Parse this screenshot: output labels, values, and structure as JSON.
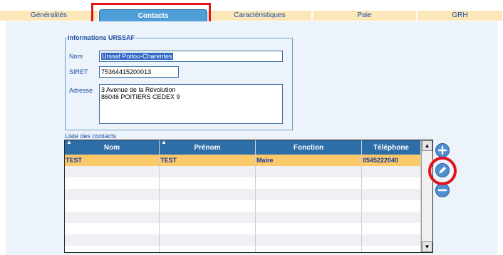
{
  "tabs": [
    {
      "label": "Généralités"
    },
    {
      "label": "Contacts",
      "active": true
    },
    {
      "label": "Caractéristiques"
    },
    {
      "label": "Paie"
    },
    {
      "label": "GRH"
    }
  ],
  "urssaf": {
    "legend": "Informations URSSAF",
    "nom_label": "Nom",
    "nom_value": "Urssaf Poitou-Charentes",
    "siret_label": "SIRET",
    "siret_value": "75364415200013",
    "adresse_label": "Adresse",
    "adresse_value": "3 Avenue de la Révolution\n86046 POITIERS CEDEX 9"
  },
  "contacts": {
    "title": "Liste des contacts",
    "columns": [
      "Nom",
      "Prénom",
      "Fonction",
      "Téléphone"
    ],
    "rows": [
      {
        "nom": "TEST",
        "prenom": "TEST",
        "fonction": "Maire",
        "telephone": "0545222040"
      }
    ],
    "selected_row_color": "#fbc96a",
    "alt_row_color": "#eef0f3"
  },
  "actions": {
    "add_icon": "plus-circle-icon",
    "edit_icon": "pencil-circle-icon",
    "remove_icon": "minus-circle-icon"
  },
  "colors": {
    "header_blue": "#2e6ea8",
    "tab_active": "#4f9ed8",
    "tab_inactive": "#fbe7b8",
    "highlight_red": "#e3121b"
  }
}
